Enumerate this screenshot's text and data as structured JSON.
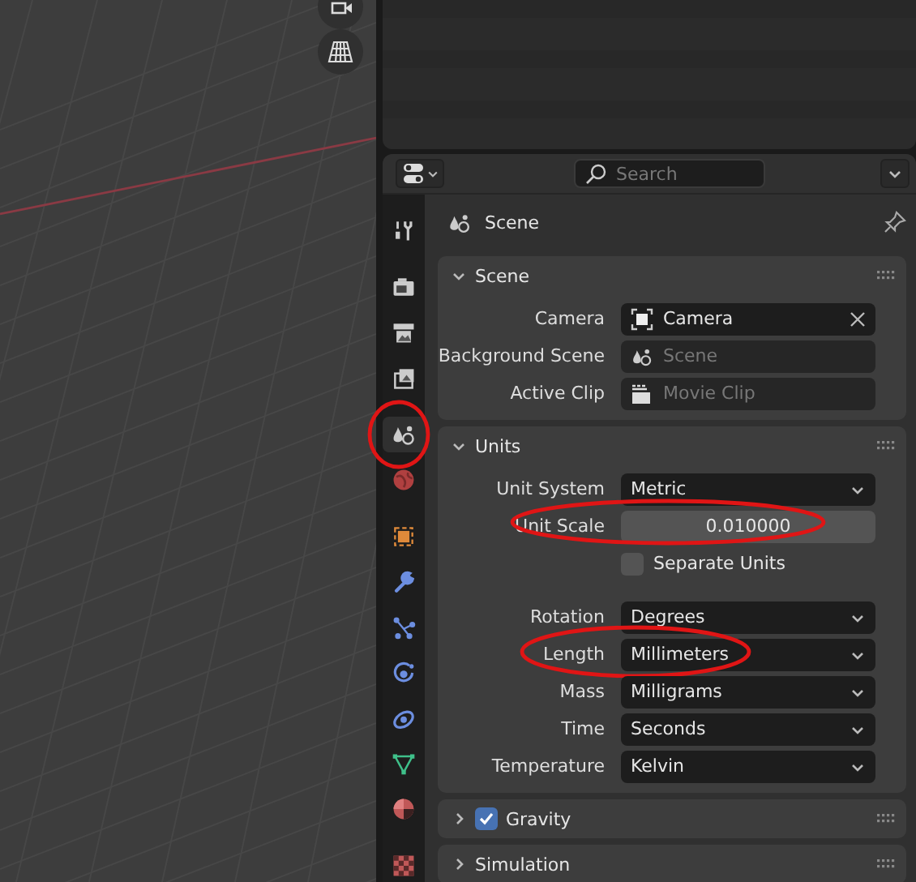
{
  "properties": {
    "search": {
      "placeholder": "Search"
    },
    "tabs": [
      {
        "kind": "tool",
        "selected": false
      },
      {
        "kind": "render",
        "selected": false
      },
      {
        "kind": "output",
        "selected": false
      },
      {
        "kind": "viewlayer",
        "selected": false
      },
      {
        "kind": "scene",
        "selected": true,
        "circled": true
      },
      {
        "kind": "world",
        "selected": false
      },
      {
        "kind": "object",
        "selected": false
      },
      {
        "kind": "modifier",
        "selected": false
      },
      {
        "kind": "particles",
        "selected": false
      },
      {
        "kind": "physics",
        "selected": false
      },
      {
        "kind": "constraints",
        "selected": false
      },
      {
        "kind": "data",
        "selected": false
      },
      {
        "kind": "material",
        "selected": false
      },
      {
        "kind": "texture",
        "selected": false
      }
    ],
    "context": {
      "title": "Scene"
    },
    "panels": [
      {
        "title": "Scene",
        "expanded": true,
        "rows": [
          {
            "kind": "camera",
            "label": "Camera",
            "value": "Camera"
          },
          {
            "kind": "scene",
            "label": "Background Scene",
            "placeholder": "Scene"
          },
          {
            "kind": "clip",
            "label": "Active Clip",
            "placeholder": "Movie Clip"
          }
        ]
      },
      {
        "title": "Units",
        "expanded": true,
        "rows": [
          {
            "kind": "dropdown",
            "label": "Unit System",
            "value": "Metric"
          },
          {
            "kind": "number",
            "label": "Unit Scale",
            "value": "0.010000",
            "circled": true
          },
          {
            "kind": "checkbox",
            "label": "Separate Units",
            "checked": false
          },
          {
            "kind": "dropdown",
            "label": "Rotation",
            "value": "Degrees"
          },
          {
            "kind": "dropdown",
            "label": "Length",
            "value": "Millimeters",
            "circled": true
          },
          {
            "kind": "dropdown",
            "label": "Mass",
            "value": "Milligrams"
          },
          {
            "kind": "dropdown",
            "label": "Time",
            "value": "Seconds"
          },
          {
            "kind": "dropdown",
            "label": "Temperature",
            "value": "Kelvin"
          }
        ]
      },
      {
        "title": "Gravity",
        "expanded": false,
        "checked": true
      },
      {
        "title": "Simulation",
        "expanded": false
      }
    ]
  }
}
